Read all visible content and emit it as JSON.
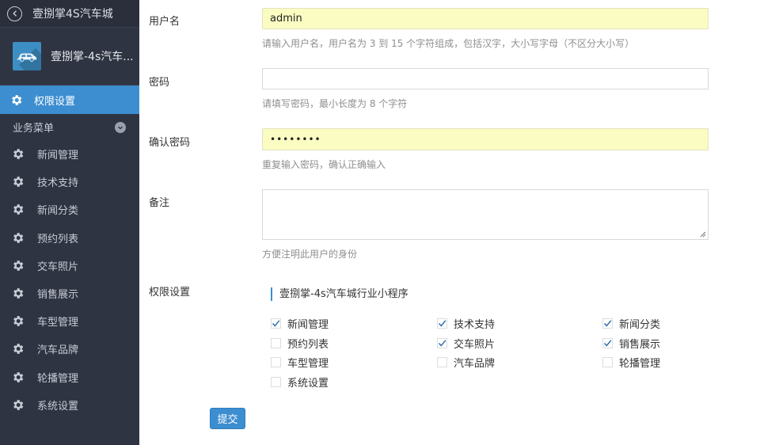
{
  "sidebar": {
    "app_title": "壹捌掌4S汽车城",
    "profile_name": "壹捌掌-4s汽车...",
    "active_item": "权限设置",
    "section_title": "业务菜单",
    "items": [
      "新闻管理",
      "技术支持",
      "新闻分类",
      "预约列表",
      "交车照片",
      "销售展示",
      "车型管理",
      "汽车品牌",
      "轮播管理",
      "系统设置"
    ]
  },
  "form": {
    "username": {
      "label": "用户名",
      "value": "admin",
      "hint": "请输入用户名，用户名为 3 到 15 个字符组成，包括汉字，大小写字母（不区分大小写）"
    },
    "password": {
      "label": "密码",
      "value": "",
      "hint": "请填写密码，最小长度为 8 个字符"
    },
    "confirm": {
      "label": "确认密码",
      "value": "••••••••",
      "hint": "重复输入密码，确认正确输入"
    },
    "remark": {
      "label": "备注",
      "value": "",
      "hint": "方便注明此用户的身份"
    },
    "permissions": {
      "label": "权限设置",
      "group_title": "壹捌掌-4s汽车城行业小程序",
      "options": [
        {
          "label": "新闻管理",
          "checked": true
        },
        {
          "label": "技术支持",
          "checked": true
        },
        {
          "label": "新闻分类",
          "checked": true
        },
        {
          "label": "预约列表",
          "checked": false
        },
        {
          "label": "交车照片",
          "checked": true
        },
        {
          "label": "销售展示",
          "checked": true
        },
        {
          "label": "车型管理",
          "checked": false
        },
        {
          "label": "汽车品牌",
          "checked": false
        },
        {
          "label": "轮播管理",
          "checked": false
        },
        {
          "label": "系统设置",
          "checked": false
        }
      ]
    },
    "submit_label": "提交"
  },
  "colors": {
    "sidebar_bg": "#2f3442",
    "accent": "#3d8ed0",
    "autofill": "#fafcc2"
  }
}
